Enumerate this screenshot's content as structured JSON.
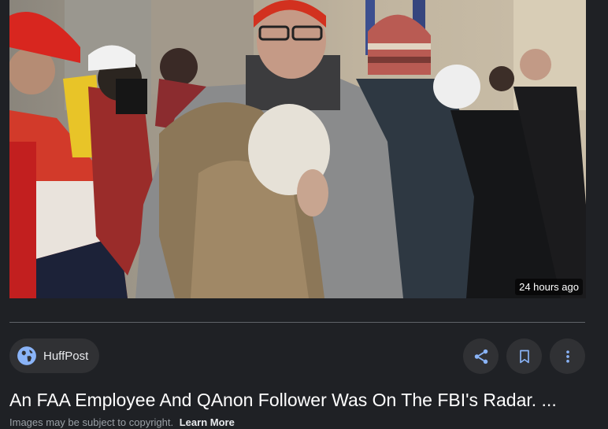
{
  "result": {
    "time_ago": "24 hours ago",
    "source": {
      "name": "HuffPost",
      "icon": "globe-icon"
    },
    "actions": [
      {
        "name": "share",
        "icon": "share-icon"
      },
      {
        "name": "save",
        "icon": "bookmark-icon"
      },
      {
        "name": "more",
        "icon": "more-vertical-icon"
      }
    ],
    "title": "An FAA Employee And QAnon Follower Was On The FBI's Radar. ...",
    "copyright_notice": "Images may be subject to copyright.",
    "learn_more": "Learn More"
  },
  "colors": {
    "background": "#1f2125",
    "chip_background": "#303134",
    "accent_icon": "#8ab4f8",
    "text_primary": "#ffffff",
    "text_secondary": "#9aa0a6"
  }
}
